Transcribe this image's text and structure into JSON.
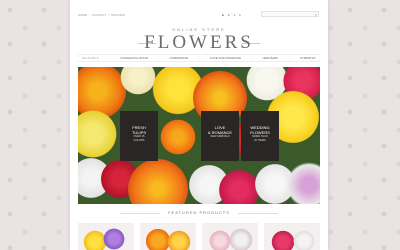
{
  "topbar": {
    "links": [
      "HOME",
      "CONTACT",
      "SITE MAP"
    ],
    "icons": [
      "cart-icon",
      "currency-icon",
      "lang-icon",
      "user-icon"
    ],
    "icon_glyphs": [
      "■",
      "$",
      "▾",
      "●"
    ],
    "search": {
      "placeholder": ""
    }
  },
  "logo": {
    "subtitle": "ONLINE STORE",
    "title": "FLOWERS"
  },
  "nav": {
    "items": [
      "BOUQUETS",
      "CONGRATULATION",
      "CORPORATE",
      "LOVE AND ROMANCE",
      "NEW BABY",
      "SYMPATHY"
    ],
    "active_index": 0
  },
  "hero": {
    "panels": [
      {
        "title_1": "FRESH",
        "title_2": "TULIPS",
        "sub_1": "OVER 16",
        "sub_2": "COLORS"
      },
      {
        "title_1": "LOVE",
        "title_2": "& ROMANCE",
        "sub_1": "NEW ARRIVALS",
        "sub_2": ""
      },
      {
        "title_1": "WEDDING",
        "title_2": "FLOWERS",
        "sub_1": "MORE THAN",
        "sub_2": "20 ITEMS"
      }
    ]
  },
  "featured": {
    "title": "FEATURED PRODUCTS"
  },
  "colors": {
    "accent": "#c9a0a8",
    "panel": "#2a2626",
    "text": "#6b6b6b"
  }
}
